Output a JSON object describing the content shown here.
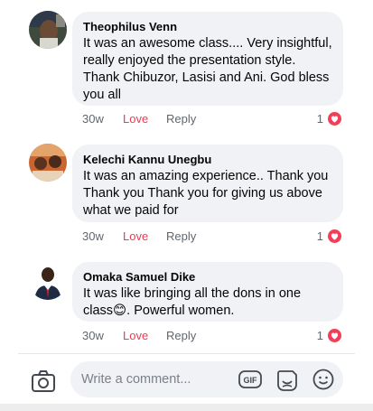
{
  "comments": [
    {
      "author": "Theophilus Venn",
      "text": "It was an awesome class.... Very insightful, really enjoyed the presentation style. Thank Chibuzor, Lasisi and Ani. God bless you all",
      "time": "30w",
      "love_label": "Love",
      "reply_label": "Reply",
      "reaction_count": "1",
      "reaction_icon": "heart-icon"
    },
    {
      "author": "Kelechi Kannu Unegbu",
      "text": "It was an amazing experience.. Thank you Thank you Thank you for giving us above what we paid for",
      "time": "30w",
      "love_label": "Love",
      "reply_label": "Reply",
      "reaction_count": "1",
      "reaction_icon": "heart-icon"
    },
    {
      "author": "Omaka Samuel Dike",
      "text": "It was like bringing all the dons in one class😊. Powerful women.",
      "time": "30w",
      "love_label": "Love",
      "reply_label": "Reply",
      "reaction_count": "1",
      "reaction_icon": "heart-icon"
    }
  ],
  "composer": {
    "placeholder": "Write a comment...",
    "icons": [
      "camera-icon",
      "gif-icon",
      "sticker-icon",
      "emoji-icon"
    ]
  },
  "colors": {
    "love": "#e0405a",
    "heart_badge": "#f33e58",
    "bubble": "#f0f2f5",
    "meta_text": "#606770"
  }
}
